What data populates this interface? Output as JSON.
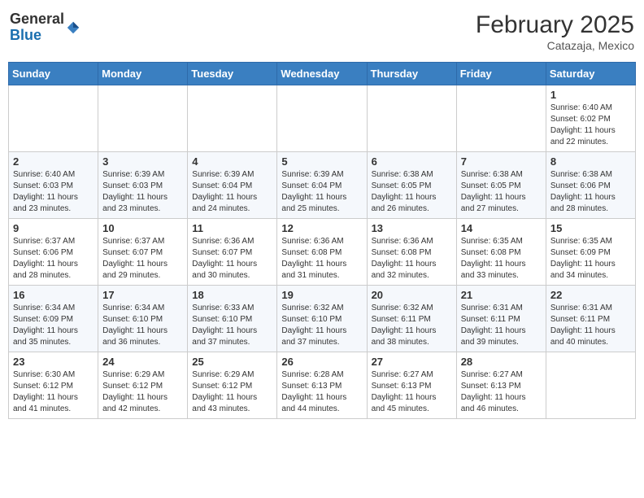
{
  "logo": {
    "general": "General",
    "blue": "Blue"
  },
  "header": {
    "month": "February 2025",
    "location": "Catazaja, Mexico"
  },
  "days_of_week": [
    "Sunday",
    "Monday",
    "Tuesday",
    "Wednesday",
    "Thursday",
    "Friday",
    "Saturday"
  ],
  "weeks": [
    [
      {
        "day": "",
        "info": ""
      },
      {
        "day": "",
        "info": ""
      },
      {
        "day": "",
        "info": ""
      },
      {
        "day": "",
        "info": ""
      },
      {
        "day": "",
        "info": ""
      },
      {
        "day": "",
        "info": ""
      },
      {
        "day": "1",
        "info": "Sunrise: 6:40 AM\nSunset: 6:02 PM\nDaylight: 11 hours and 22 minutes."
      }
    ],
    [
      {
        "day": "2",
        "info": "Sunrise: 6:40 AM\nSunset: 6:03 PM\nDaylight: 11 hours and 23 minutes."
      },
      {
        "day": "3",
        "info": "Sunrise: 6:39 AM\nSunset: 6:03 PM\nDaylight: 11 hours and 23 minutes."
      },
      {
        "day": "4",
        "info": "Sunrise: 6:39 AM\nSunset: 6:04 PM\nDaylight: 11 hours and 24 minutes."
      },
      {
        "day": "5",
        "info": "Sunrise: 6:39 AM\nSunset: 6:04 PM\nDaylight: 11 hours and 25 minutes."
      },
      {
        "day": "6",
        "info": "Sunrise: 6:38 AM\nSunset: 6:05 PM\nDaylight: 11 hours and 26 minutes."
      },
      {
        "day": "7",
        "info": "Sunrise: 6:38 AM\nSunset: 6:05 PM\nDaylight: 11 hours and 27 minutes."
      },
      {
        "day": "8",
        "info": "Sunrise: 6:38 AM\nSunset: 6:06 PM\nDaylight: 11 hours and 28 minutes."
      }
    ],
    [
      {
        "day": "9",
        "info": "Sunrise: 6:37 AM\nSunset: 6:06 PM\nDaylight: 11 hours and 28 minutes."
      },
      {
        "day": "10",
        "info": "Sunrise: 6:37 AM\nSunset: 6:07 PM\nDaylight: 11 hours and 29 minutes."
      },
      {
        "day": "11",
        "info": "Sunrise: 6:36 AM\nSunset: 6:07 PM\nDaylight: 11 hours and 30 minutes."
      },
      {
        "day": "12",
        "info": "Sunrise: 6:36 AM\nSunset: 6:08 PM\nDaylight: 11 hours and 31 minutes."
      },
      {
        "day": "13",
        "info": "Sunrise: 6:36 AM\nSunset: 6:08 PM\nDaylight: 11 hours and 32 minutes."
      },
      {
        "day": "14",
        "info": "Sunrise: 6:35 AM\nSunset: 6:08 PM\nDaylight: 11 hours and 33 minutes."
      },
      {
        "day": "15",
        "info": "Sunrise: 6:35 AM\nSunset: 6:09 PM\nDaylight: 11 hours and 34 minutes."
      }
    ],
    [
      {
        "day": "16",
        "info": "Sunrise: 6:34 AM\nSunset: 6:09 PM\nDaylight: 11 hours and 35 minutes."
      },
      {
        "day": "17",
        "info": "Sunrise: 6:34 AM\nSunset: 6:10 PM\nDaylight: 11 hours and 36 minutes."
      },
      {
        "day": "18",
        "info": "Sunrise: 6:33 AM\nSunset: 6:10 PM\nDaylight: 11 hours and 37 minutes."
      },
      {
        "day": "19",
        "info": "Sunrise: 6:32 AM\nSunset: 6:10 PM\nDaylight: 11 hours and 37 minutes."
      },
      {
        "day": "20",
        "info": "Sunrise: 6:32 AM\nSunset: 6:11 PM\nDaylight: 11 hours and 38 minutes."
      },
      {
        "day": "21",
        "info": "Sunrise: 6:31 AM\nSunset: 6:11 PM\nDaylight: 11 hours and 39 minutes."
      },
      {
        "day": "22",
        "info": "Sunrise: 6:31 AM\nSunset: 6:11 PM\nDaylight: 11 hours and 40 minutes."
      }
    ],
    [
      {
        "day": "23",
        "info": "Sunrise: 6:30 AM\nSunset: 6:12 PM\nDaylight: 11 hours and 41 minutes."
      },
      {
        "day": "24",
        "info": "Sunrise: 6:29 AM\nSunset: 6:12 PM\nDaylight: 11 hours and 42 minutes."
      },
      {
        "day": "25",
        "info": "Sunrise: 6:29 AM\nSunset: 6:12 PM\nDaylight: 11 hours and 43 minutes."
      },
      {
        "day": "26",
        "info": "Sunrise: 6:28 AM\nSunset: 6:13 PM\nDaylight: 11 hours and 44 minutes."
      },
      {
        "day": "27",
        "info": "Sunrise: 6:27 AM\nSunset: 6:13 PM\nDaylight: 11 hours and 45 minutes."
      },
      {
        "day": "28",
        "info": "Sunrise: 6:27 AM\nSunset: 6:13 PM\nDaylight: 11 hours and 46 minutes."
      },
      {
        "day": "",
        "info": ""
      }
    ]
  ]
}
